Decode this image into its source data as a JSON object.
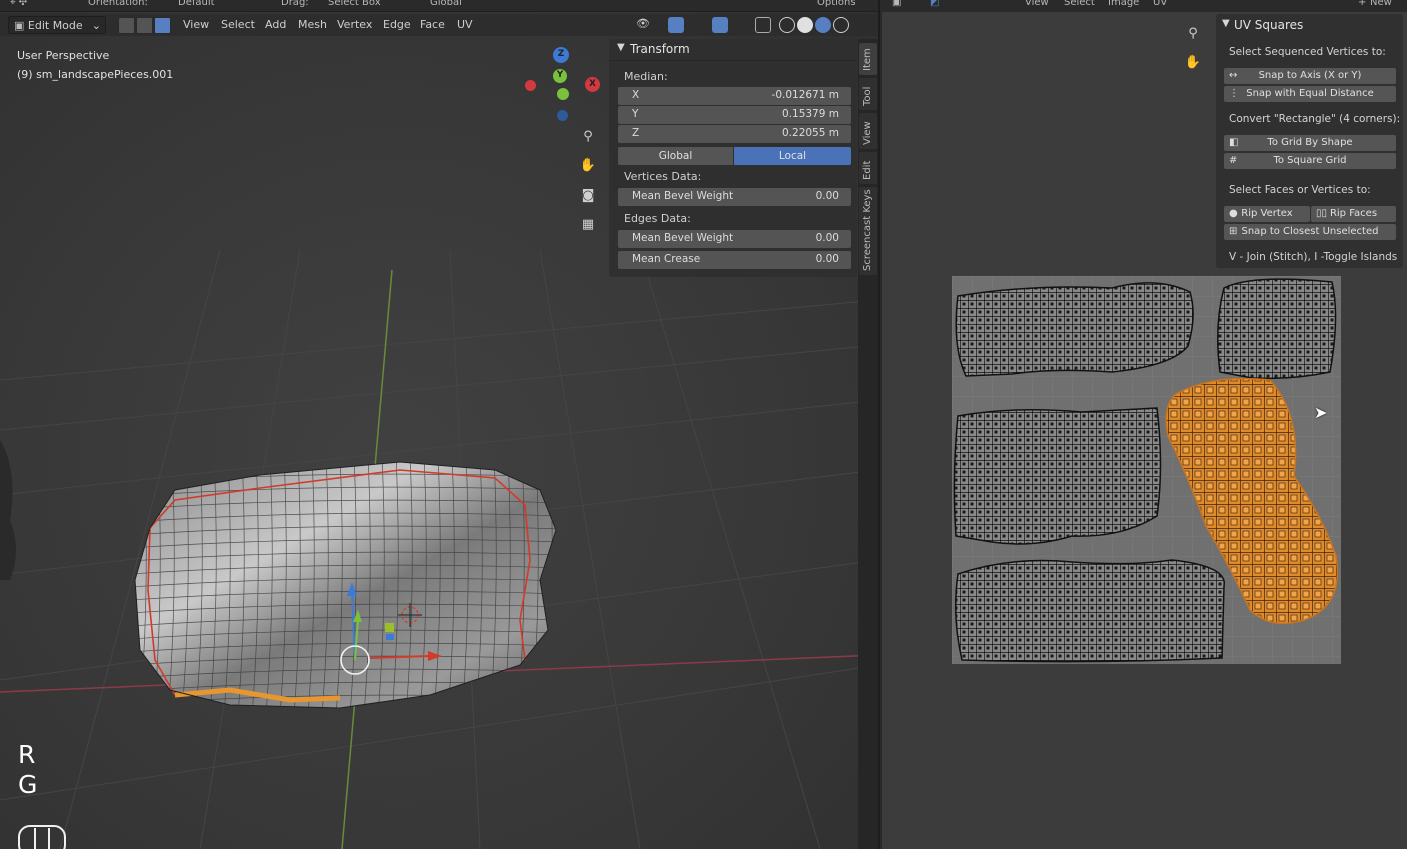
{
  "viewport": {
    "topbar": {
      "orientation_label": "Orientation:",
      "orientation_value": "Default",
      "drag_label": "Drag:",
      "drag_value": "Select Box",
      "transform_value": "Global",
      "options_label": "Options"
    },
    "mode": "Edit Mode",
    "menus": [
      "View",
      "Select",
      "Add",
      "Mesh",
      "Vertex",
      "Edge",
      "Face",
      "UV"
    ],
    "info": {
      "view_name": "User Perspective",
      "object_name": "(9) sm_landscapePieces.001"
    },
    "gizmo": {
      "z": "Z",
      "y": "Y",
      "x": "X"
    },
    "key_hints": [
      "R",
      "G"
    ]
  },
  "transform_panel": {
    "title": "Transform",
    "median_label": "Median:",
    "coords": [
      {
        "axis": "X",
        "value": "-0.012671 m"
      },
      {
        "axis": "Y",
        "value": "0.15379 m"
      },
      {
        "axis": "Z",
        "value": "0.22055 m"
      }
    ],
    "space_options": [
      "Global",
      "Local"
    ],
    "space_selected": "Local",
    "vertices_label": "Vertices Data:",
    "vertex_bevel": {
      "label": "Mean Bevel Weight",
      "value": "0.00"
    },
    "edges_label": "Edges Data:",
    "edge_bevel": {
      "label": "Mean Bevel Weight",
      "value": "0.00"
    },
    "edge_crease": {
      "label": "Mean Crease",
      "value": "0.00"
    }
  },
  "side_tabs": [
    "Item",
    "Tool",
    "View",
    "Edit",
    "Screencast Keys"
  ],
  "uv_editor": {
    "menus": [
      "View",
      "Select",
      "Image",
      "UV"
    ],
    "new_label": "New",
    "panel_title": "UV Squares",
    "section1": "Select Sequenced Vertices to:",
    "snap_axis": "Snap to Axis (X or Y)",
    "snap_equal": "Snap with Equal Distance",
    "section2": "Convert \"Rectangle\" (4 corners):",
    "grid_shape": "To Grid By Shape",
    "square_grid": "To Square Grid",
    "section3": "Select Faces or Vertices to:",
    "rip_vertex": "Rip Vertex",
    "rip_faces": "Rip Faces",
    "snap_closest": "Snap to Closest Unselected",
    "hint": "V - Join (Stitch), I -Toggle Islands"
  },
  "colors": {
    "accent": "#5680c2",
    "selection_orange": "#e8962f",
    "edge_red": "#d23a2a",
    "header": "#2d2d2d",
    "panel": "#303030"
  }
}
